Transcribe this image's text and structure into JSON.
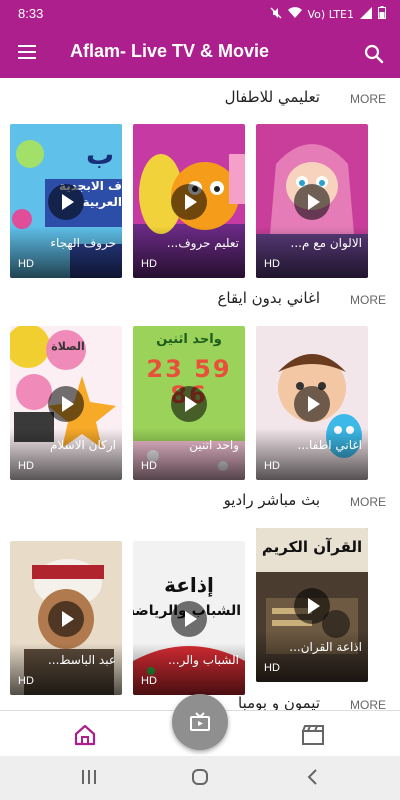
{
  "status_bar": {
    "time": "8:33",
    "network": "Vo) LTE1"
  },
  "app_bar": {
    "title": "Aflam- Live TV & Movie"
  },
  "sections": [
    {
      "title": "تعليمي للاطفال",
      "more_label": "MORE",
      "cards": [
        {
          "title": "حروف الهجاء",
          "badge": "HD"
        },
        {
          "title": "تعليم حروف...",
          "badge": "HD"
        },
        {
          "title": "الالوان مع م...",
          "badge": "HD"
        }
      ]
    },
    {
      "title": "اغاني  بدون ايقاع",
      "more_label": "MORE",
      "cards": [
        {
          "title": "اركان الاسلام",
          "badge": "HD"
        },
        {
          "title": "واحد اتنين",
          "badge": "HD"
        },
        {
          "title": "اغاني اطفا...",
          "badge": "HD"
        }
      ]
    },
    {
      "title": "بث مباشر راديو",
      "more_label": "MORE",
      "cards": [
        {
          "title": "عبد الباسط...",
          "badge": "HD"
        },
        {
          "title": "الشباب والر...",
          "badge": "HD"
        },
        {
          "title": "اذاعة القران...",
          "badge": "HD"
        }
      ]
    },
    {
      "title": "تيمون و بومبا",
      "more_label": "MORE",
      "cards": []
    }
  ],
  "thumbnail_text": {
    "arabic_alphabet": "ف الابجدية العربية",
    "letter": "ب",
    "salah": "الصلاة",
    "wahid_ithnain": "واحد اثنين",
    "digits": "23 59 86",
    "broadcast": "إذاعة",
    "youth_sports": "الشباب والرياضة",
    "quran": "القرآن الكريم"
  },
  "colors": {
    "primary": "#ad1f8c",
    "nav_active": "#ad1f8c",
    "fab": "#8f8f8f"
  },
  "icons": [
    "menu-icon",
    "search-icon",
    "home-icon",
    "tv-icon",
    "movie-clapper-icon",
    "play-icon",
    "recent-apps-icon",
    "home-circle-icon",
    "back-icon"
  ]
}
